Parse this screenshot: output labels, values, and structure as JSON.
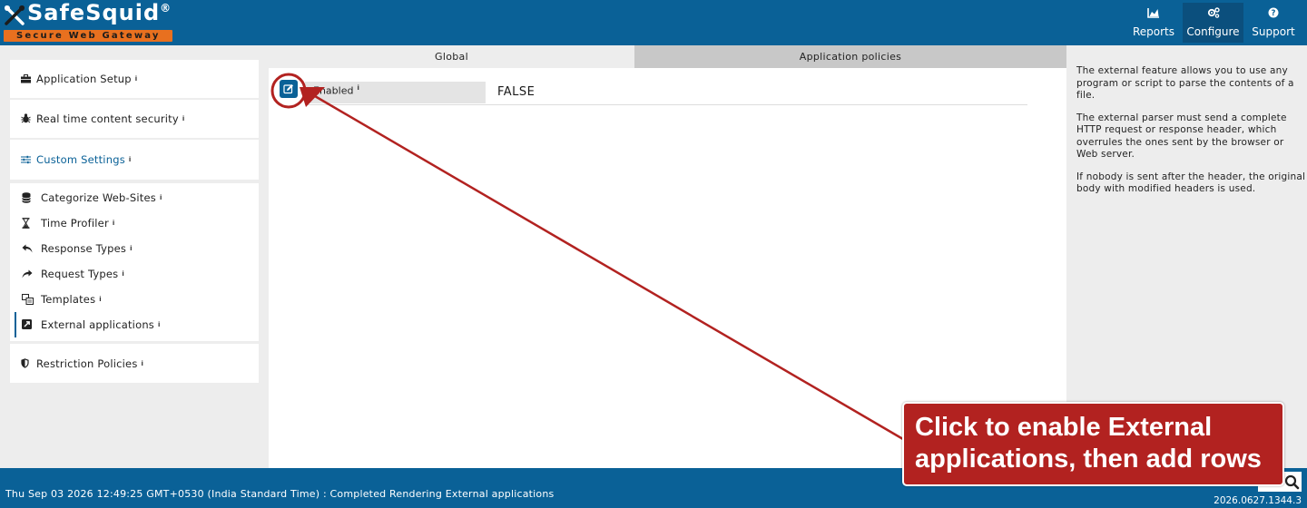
{
  "header": {
    "logo_title": "SafeSquid",
    "logo_reg": "®",
    "logo_tagline": "Secure Web Gateway",
    "nav": [
      {
        "label": "Reports",
        "icon": "chart-icon"
      },
      {
        "label": "Configure",
        "icon": "gears-icon"
      },
      {
        "label": "Support",
        "icon": "question-icon"
      }
    ]
  },
  "sidebar": {
    "top_items": [
      {
        "label": "Application Setup",
        "icon": "briefcase-icon"
      },
      {
        "label": "Real time content security",
        "icon": "bug-icon"
      },
      {
        "label": "Custom Settings",
        "icon": "sliders-icon"
      }
    ],
    "sub_items": [
      {
        "label": "Categorize Web-Sites",
        "icon": "database-icon"
      },
      {
        "label": "Time Profiler",
        "icon": "hourglass-icon"
      },
      {
        "label": "Response Types",
        "icon": "reply-icon"
      },
      {
        "label": "Request Types",
        "icon": "forward-icon"
      },
      {
        "label": "Templates",
        "icon": "templates-icon"
      },
      {
        "label": "External applications",
        "icon": "external-icon"
      }
    ],
    "bottom_item": {
      "label": "Restriction Policies",
      "icon": "shield-icon"
    },
    "info_glyph": "i"
  },
  "main": {
    "tabs": [
      {
        "label": "Global"
      },
      {
        "label": "Application policies"
      }
    ],
    "field": {
      "label": "Enabled",
      "value": "FALSE"
    }
  },
  "help": {
    "paragraphs": [
      "The external feature allows you to use any program or script to parse the contents of a file.",
      "The external parser must send a complete HTTP request or response header, which overrules the ones sent by the browser or Web server.",
      "If nobody is sent after the header, the original body with modified headers is used."
    ]
  },
  "footer": {
    "status": "Thu Sep 03 2026 12:49:25 GMT+0530 (India Standard Time) : Completed Rendering External applications",
    "version": "2026.0627.1344.3"
  },
  "annotation": {
    "text_line1": "Click to enable External",
    "text_line2": "applications, then add rows",
    "color": "#b22220"
  },
  "colors": {
    "brand_blue": "#0a6197",
    "brand_orange": "#e8701f",
    "annotation_red": "#b22220"
  }
}
